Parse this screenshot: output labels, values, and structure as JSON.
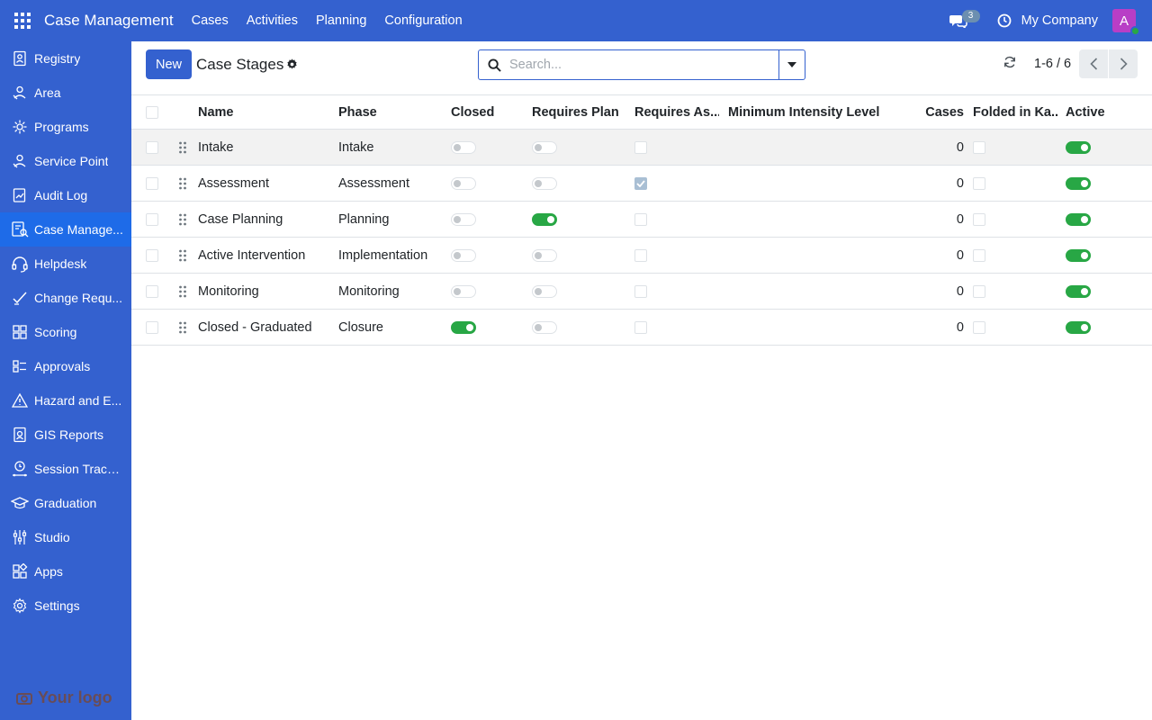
{
  "navbar": {
    "brand": "Case Management",
    "menu": [
      "Cases",
      "Activities",
      "Planning",
      "Configuration"
    ],
    "chat_count": "3",
    "company": "My Company",
    "avatar_letter": "A"
  },
  "sidebar": {
    "items": [
      {
        "label": "Registry",
        "icon": "registry-icon"
      },
      {
        "label": "Area",
        "icon": "area-icon"
      },
      {
        "label": "Programs",
        "icon": "programs-icon"
      },
      {
        "label": "Service Point",
        "icon": "service-point-icon"
      },
      {
        "label": "Audit Log",
        "icon": "audit-log-icon"
      },
      {
        "label": "Case Manage...",
        "icon": "case-management-icon",
        "active": true
      },
      {
        "label": "Helpdesk",
        "icon": "headset-icon"
      },
      {
        "label": "Change Requ...",
        "icon": "change-request-icon"
      },
      {
        "label": "Scoring",
        "icon": "scoring-icon"
      },
      {
        "label": "Approvals",
        "icon": "approvals-icon"
      },
      {
        "label": "Hazard and E...",
        "icon": "hazard-icon"
      },
      {
        "label": "GIS Reports",
        "icon": "gis-reports-icon"
      },
      {
        "label": "Session Tracki...",
        "icon": "session-tracking-icon"
      },
      {
        "label": "Graduation",
        "icon": "graduation-cap-icon"
      },
      {
        "label": "Studio",
        "icon": "studio-icon"
      },
      {
        "label": "Apps",
        "icon": "apps-icon"
      },
      {
        "label": "Settings",
        "icon": "settings-icon"
      }
    ],
    "logo_text": "Your logo"
  },
  "control": {
    "new_label": "New",
    "title": "Case Stages",
    "search_placeholder": "Search...",
    "pager_value": "1-6 / 6"
  },
  "table": {
    "columns": [
      "Name",
      "Phase",
      "Closed",
      "Requires Plan",
      "Requires As...",
      "Minimum Intensity Level",
      "Cases",
      "Folded in Ka...",
      "Active"
    ],
    "rows": [
      {
        "name": "Intake",
        "phase": "Intake",
        "closed": false,
        "requires_plan": false,
        "requires_assessment": false,
        "min_intensity": "",
        "cases": "0",
        "folded": false,
        "active": true
      },
      {
        "name": "Assessment",
        "phase": "Assessment",
        "closed": false,
        "requires_plan": false,
        "requires_assessment": true,
        "min_intensity": "",
        "cases": "0",
        "folded": false,
        "active": true
      },
      {
        "name": "Case Planning",
        "phase": "Planning",
        "closed": false,
        "requires_plan": true,
        "requires_assessment": false,
        "min_intensity": "",
        "cases": "0",
        "folded": false,
        "active": true
      },
      {
        "name": "Active Intervention",
        "phase": "Implementation",
        "closed": false,
        "requires_plan": false,
        "requires_assessment": false,
        "min_intensity": "",
        "cases": "0",
        "folded": false,
        "active": true
      },
      {
        "name": "Monitoring",
        "phase": "Monitoring",
        "closed": false,
        "requires_plan": false,
        "requires_assessment": false,
        "min_intensity": "",
        "cases": "0",
        "folded": false,
        "active": true
      },
      {
        "name": "Closed - Graduated",
        "phase": "Closure",
        "closed": true,
        "requires_plan": false,
        "requires_assessment": false,
        "min_intensity": "",
        "cases": "0",
        "folded": false,
        "active": true
      }
    ]
  },
  "colors": {
    "primary": "#3461cf",
    "active_sidebar": "#1e6be8",
    "toggle_on": "#28a745"
  }
}
